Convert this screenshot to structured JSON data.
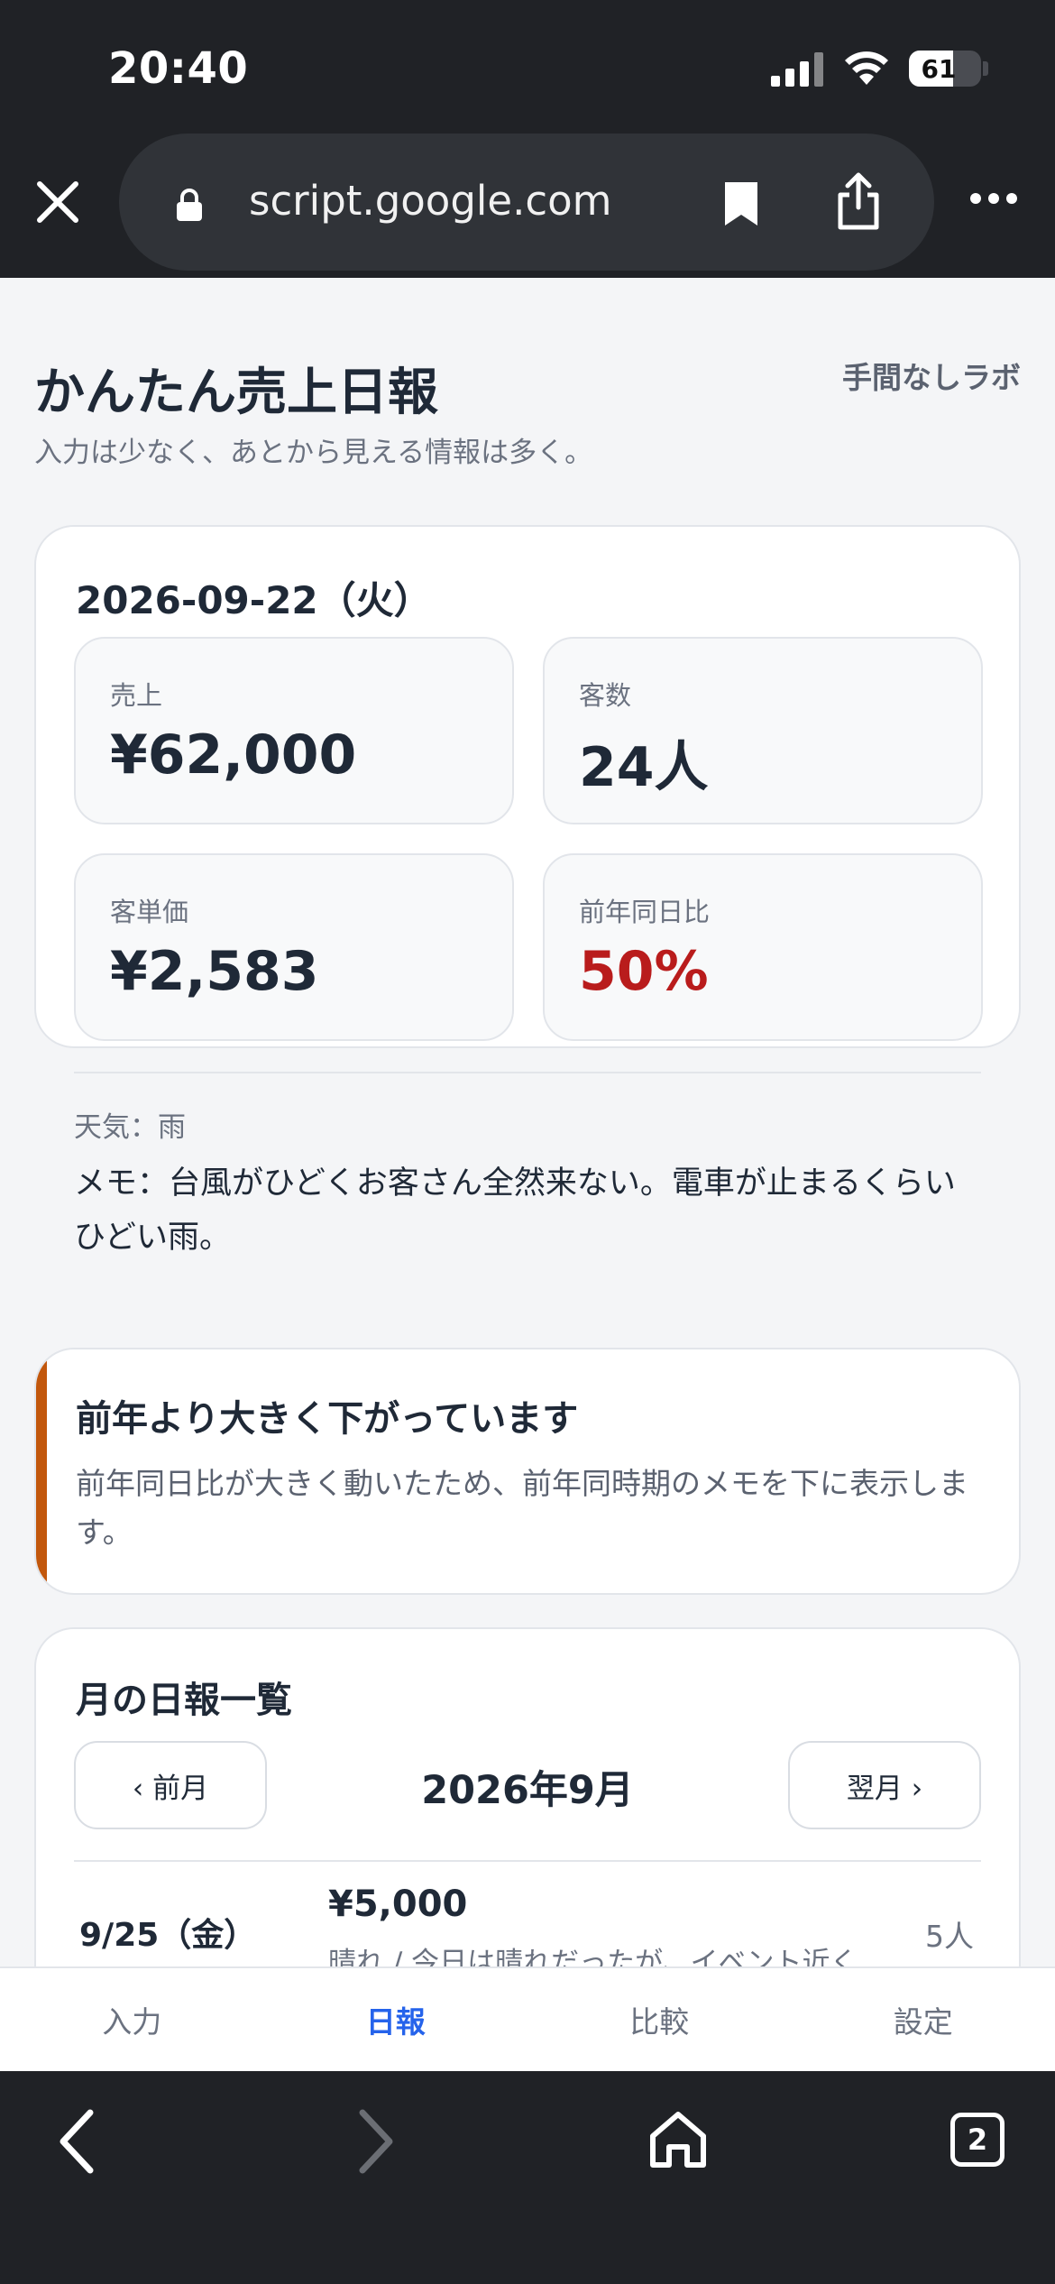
{
  "status": {
    "time": "20:40",
    "battery": "61"
  },
  "browser": {
    "url": "script.google.com",
    "tab_count": "2"
  },
  "app": {
    "title": "かんたん売上日報",
    "brand": "手間なしラボ",
    "subtitle": "入力は少なく、あとから見える情報は多く。"
  },
  "day": {
    "date": "2026-09-22（火）",
    "metrics": [
      {
        "label": "売上",
        "value": "¥62,000"
      },
      {
        "label": "客数",
        "value": "24人"
      },
      {
        "label": "客単価",
        "value": "¥2,583"
      },
      {
        "label": "前年同日比",
        "value": "50%"
      }
    ],
    "weather": "天気：雨",
    "memo": "メモ：台風がひどくお客さん全然来ない。電車が止まるくらいひどい雨。"
  },
  "alert": {
    "title": "前年より大きく下がっています",
    "body": "前年同日比が大きく動いたため、前年同時期のメモを下に表示します。"
  },
  "monthly": {
    "title": "月の日報一覧",
    "prev_label": "‹ 前月",
    "next_label": "翌月 ›",
    "month": "2026年9月",
    "rows": [
      {
        "date": "9/25（金）",
        "sales": "¥5,000",
        "note": "晴れ / 今日は晴れだったが、イベント近く",
        "count": "5人"
      }
    ]
  },
  "tabs": [
    {
      "label": "入力",
      "active": false
    },
    {
      "label": "日報",
      "active": true
    },
    {
      "label": "比較",
      "active": false
    },
    {
      "label": "設定",
      "active": false
    }
  ],
  "colors": {
    "accent": "#2563eb",
    "alert": "#c2570c",
    "negative": "#b91c1c"
  }
}
